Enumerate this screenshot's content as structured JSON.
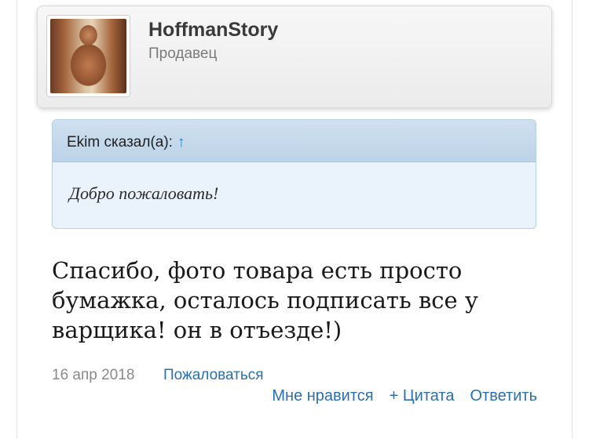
{
  "user": {
    "name": "HoffmanStory",
    "title": "Продавец"
  },
  "quote": {
    "author_line": "Ekim сказал(а):",
    "arrow": "↑",
    "text": "Добро пожаловать!"
  },
  "post": {
    "message": "Спасибо, фото товара есть просто бумажка, осталось подписать все у варщика! он в отъезде!)",
    "date": "16 апр 2018",
    "report_label": "Пожаловаться",
    "actions": {
      "like": "Мне нравится",
      "quote": "+ Цитата",
      "reply": "Ответить"
    }
  },
  "colors": {
    "link": "#2a6fb4",
    "quote_bg": "#eaf3fc",
    "quote_header": "#c6dbed"
  }
}
